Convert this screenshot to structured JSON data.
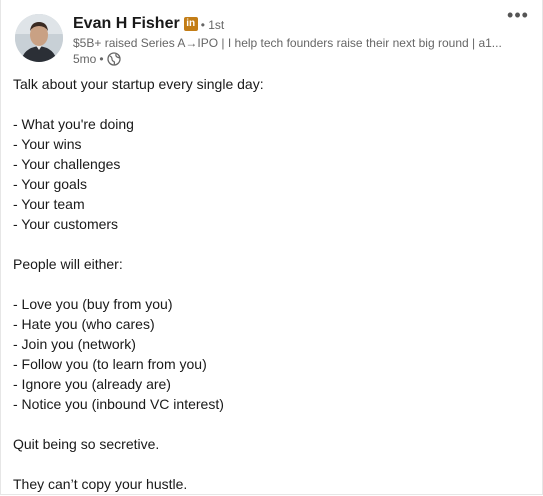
{
  "author": {
    "name": "Evan H Fisher",
    "badge": "in",
    "connection_degree": "• 1st",
    "headline": "$5B+ raised Series A→IPO | I help tech founders raise their next big round | a1...",
    "post_age": "5mo",
    "visibility_icon": "globe-icon"
  },
  "menu": {
    "more_label": "•••"
  },
  "post": {
    "lines": [
      "Talk about your startup every single day:",
      "",
      "- What you're doing",
      "- Your wins",
      "- Your challenges",
      "- Your goals",
      "- Your team",
      "- Your customers",
      "",
      "People will either:",
      "",
      "- Love you (buy from you)",
      "- Hate you (who cares)",
      "- Join you (network)",
      "- Follow you (to learn from you)",
      "- Ignore you (already are)",
      "- Notice you (inbound VC interest)",
      "",
      "Quit being so secretive.",
      "",
      "They can’t copy your hustle."
    ]
  },
  "colors": {
    "badge_bg": "#c37d16",
    "text_primary": "#191919",
    "text_secondary": "#666666"
  }
}
